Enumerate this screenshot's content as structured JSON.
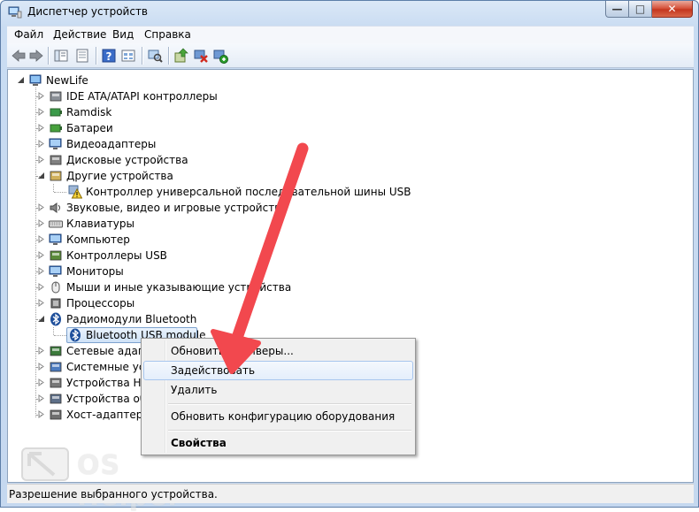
{
  "window": {
    "title": "Диспетчер устройств",
    "buttons": {
      "minimize": "—",
      "maximize": "□",
      "close": "✕"
    }
  },
  "menu": [
    "Файл",
    "Действие",
    "Вид",
    "Справка"
  ],
  "toolbar": {
    "icons": [
      "back-arrow-icon",
      "forward-arrow-icon",
      "show-hide-console-tree-icon",
      "properties-icon",
      "help-icon",
      "view-icon",
      "scan-hardware-icon",
      "update-driver-icon",
      "uninstall-icon",
      "enable-device-icon"
    ]
  },
  "tree": {
    "root": "NewLife",
    "items": [
      {
        "label": "IDE ATA/ATAPI контроллеры",
        "icon": "ide-controller-icon",
        "expanded": false
      },
      {
        "label": "Ramdisk",
        "icon": "ramdisk-icon",
        "expanded": false
      },
      {
        "label": "Батареи",
        "icon": "battery-icon",
        "expanded": false
      },
      {
        "label": "Видеоадаптеры",
        "icon": "display-adapter-icon",
        "expanded": false
      },
      {
        "label": "Дисковые устройства",
        "icon": "disk-drive-icon",
        "expanded": false
      },
      {
        "label": "Другие устройства",
        "icon": "other-devices-icon",
        "expanded": true
      },
      {
        "label": "Контроллер универсальной последовательной шины USB",
        "icon": "warning-device-icon",
        "child": true
      },
      {
        "label": "Звуковые, видео и игровые устройства",
        "icon": "sound-icon",
        "expanded": false
      },
      {
        "label": "Клавиатуры",
        "icon": "keyboard-icon",
        "expanded": false
      },
      {
        "label": "Компьютер",
        "icon": "computer-icon",
        "expanded": false
      },
      {
        "label": "Контроллеры USB",
        "icon": "usb-controller-icon",
        "expanded": false
      },
      {
        "label": "Мониторы",
        "icon": "monitor-icon",
        "expanded": false
      },
      {
        "label": "Мыши и иные указывающие устройства",
        "icon": "mouse-icon",
        "expanded": false
      },
      {
        "label": "Процессоры",
        "icon": "processor-icon",
        "expanded": false
      },
      {
        "label": "Радиомодули Bluetooth",
        "icon": "bluetooth-icon",
        "expanded": true
      },
      {
        "label": "Bluetooth USB module",
        "icon": "bluetooth-device-icon",
        "child": true,
        "selected": true
      },
      {
        "label": "Сетевые адаптеры",
        "icon": "network-adapter-icon",
        "expanded": false
      },
      {
        "label": "Системные устройства",
        "icon": "system-devices-icon",
        "expanded": false
      },
      {
        "label": "Устройства HID",
        "icon": "hid-icon",
        "expanded": false
      },
      {
        "label": "Устройства обработки изображений",
        "icon": "imaging-icon",
        "expanded": false
      },
      {
        "label": "Хост-адаптеры запоминающих устройств",
        "icon": "storage-adapter-icon",
        "expanded": false
      }
    ]
  },
  "context_menu": {
    "update": "Обновить драйверы...",
    "enable": "Задействовать",
    "delete": "Удалить",
    "scan": "Обновить конфигурацию оборудования",
    "properties": "Свойства"
  },
  "status": "Разрешение выбранного устройства.",
  "watermark": {
    "text": "OS Helper"
  },
  "colors": {
    "arrow": "#f2484e",
    "selection": "#cfe2f7",
    "title_bg": "#c9dcf2"
  }
}
